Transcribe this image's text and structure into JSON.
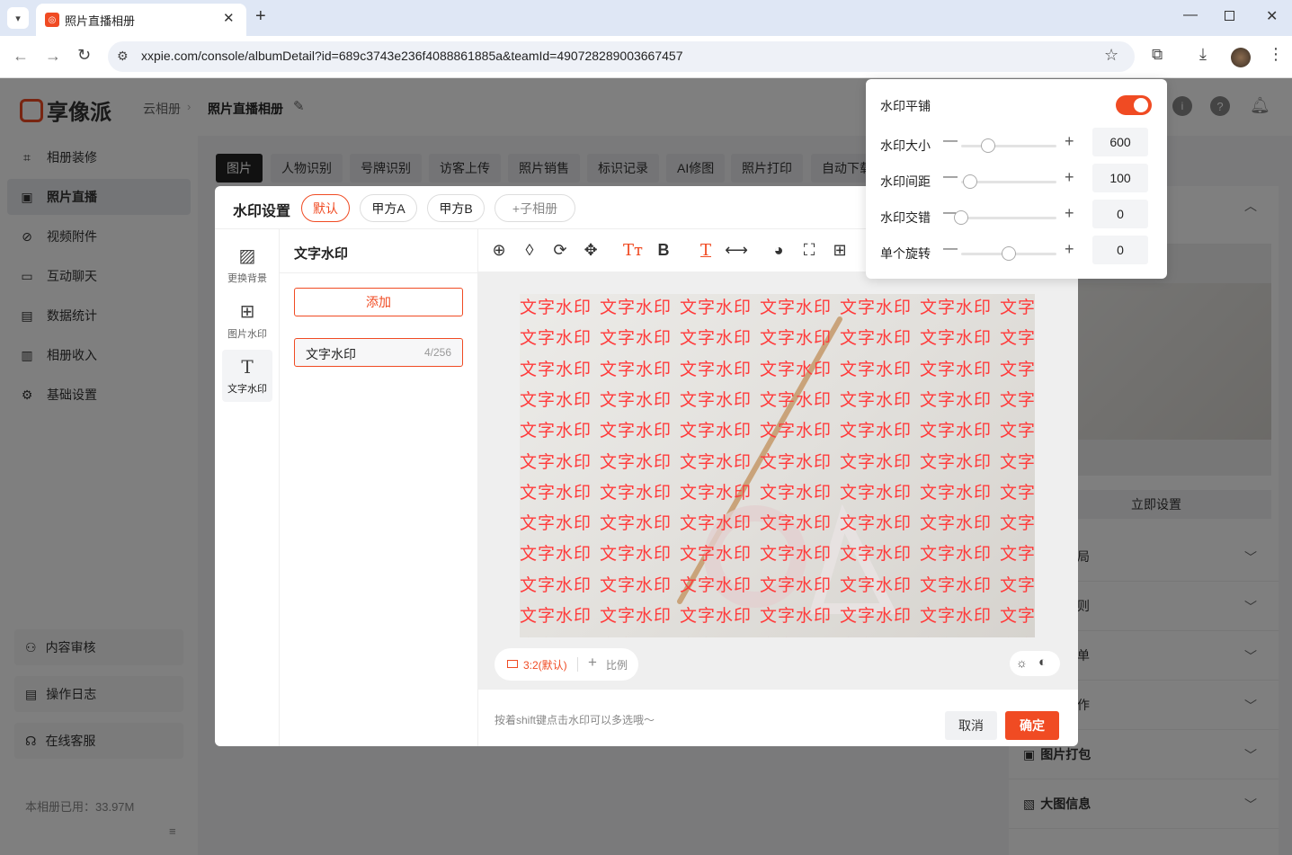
{
  "browser": {
    "tab_title": "照片直播相册",
    "url": "xxpie.com/console/albumDetail?id=689c3743e236f4088861885a&teamId=490728289003667457"
  },
  "brand": {
    "logo_text": "享像派",
    "accent": "#f04b23"
  },
  "breadcrumb": {
    "root": "云相册",
    "current": "照片直播相册"
  },
  "sidebar": {
    "items": [
      {
        "label": "相册装修",
        "icon": "scan-icon"
      },
      {
        "label": "照片直播",
        "icon": "image-icon"
      },
      {
        "label": "视频附件",
        "icon": "paperclip-icon"
      },
      {
        "label": "互动聊天",
        "icon": "chat-icon"
      },
      {
        "label": "数据统计",
        "icon": "chart-icon"
      },
      {
        "label": "相册收入",
        "icon": "wallet-icon"
      },
      {
        "label": "基础设置",
        "icon": "gear-icon"
      }
    ],
    "bottom": [
      {
        "label": "内容审核",
        "icon": "user-icon"
      },
      {
        "label": "操作日志",
        "icon": "log-icon"
      },
      {
        "label": "在线客服",
        "icon": "headset-icon"
      }
    ],
    "usage": "本相册已用：33.97M"
  },
  "content_tabs": [
    "图片",
    "人物识别",
    "号牌识别",
    "访客上传",
    "照片销售",
    "标识记录",
    "AI修图",
    "照片打印",
    "自动下载"
  ],
  "right_panel": {
    "set_button": "立即设置",
    "rows": [
      "局",
      "则",
      "单",
      "作",
      "图片打包",
      "大图信息"
    ]
  },
  "modal": {
    "title": "水印设置",
    "tabs": [
      "默认",
      "甲方A",
      "甲方B"
    ],
    "add_sub": "+子相册",
    "left_menu": [
      {
        "label": "更换背景",
        "icon": "background-icon"
      },
      {
        "label": "图片水印",
        "icon": "image-add-icon"
      },
      {
        "label": "文字水印",
        "icon": "text-icon"
      }
    ],
    "section_title": "文字水印",
    "add_button": "添加",
    "watermark_item": {
      "label": "文字水印",
      "count": "4/256"
    },
    "watermark_text": "文字水印",
    "ratio": "3:2(默认)",
    "ratio_add": "比例",
    "hint": "按着shift键点击水印可以多选哦～",
    "cancel": "取消",
    "confirm": "确定"
  },
  "popover": {
    "tile_label": "水印平铺",
    "tile_on": true,
    "rows": [
      {
        "label": "水印大小",
        "value": "600",
        "level": 0.28
      },
      {
        "label": "水印间距",
        "value": "100",
        "level": 0.09
      },
      {
        "label": "水印交错",
        "value": "0",
        "level": 0.0
      },
      {
        "label": "单个旋转",
        "value": "0",
        "level": 0.5
      }
    ]
  }
}
